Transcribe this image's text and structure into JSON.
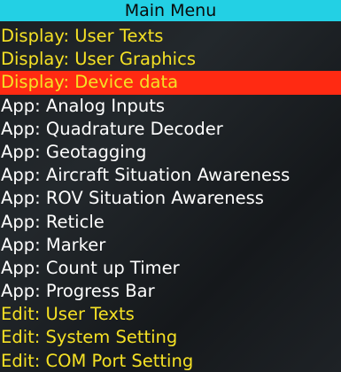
{
  "header": {
    "title": "Main Menu"
  },
  "colors": {
    "header_bg": "#23d0e4",
    "selected_bg": "#ff2a12",
    "text_yellow": "#f5e125",
    "text_white": "#ffffff"
  },
  "menu": {
    "items": [
      {
        "label": "Display: User Texts",
        "color": "yellow",
        "selected": false
      },
      {
        "label": "Display: User Graphics",
        "color": "yellow",
        "selected": false
      },
      {
        "label": "Display: Device data",
        "color": "yellow",
        "selected": true
      },
      {
        "label": "App: Analog Inputs",
        "color": "white",
        "selected": false
      },
      {
        "label": "App: Quadrature Decoder",
        "color": "white",
        "selected": false
      },
      {
        "label": "App: Geotagging",
        "color": "white",
        "selected": false
      },
      {
        "label": "App: Aircraft Situation Awareness",
        "color": "white",
        "selected": false
      },
      {
        "label": "App: ROV Situation Awareness",
        "color": "white",
        "selected": false
      },
      {
        "label": "App: Reticle",
        "color": "white",
        "selected": false
      },
      {
        "label": "App: Marker",
        "color": "white",
        "selected": false
      },
      {
        "label": "App: Count up Timer",
        "color": "white",
        "selected": false
      },
      {
        "label": "App: Progress Bar",
        "color": "white",
        "selected": false
      },
      {
        "label": "Edit: User Texts",
        "color": "yellow",
        "selected": false
      },
      {
        "label": "Edit: System Setting",
        "color": "yellow",
        "selected": false
      },
      {
        "label": "Edit: COM Port Setting",
        "color": "yellow",
        "selected": false
      }
    ]
  }
}
